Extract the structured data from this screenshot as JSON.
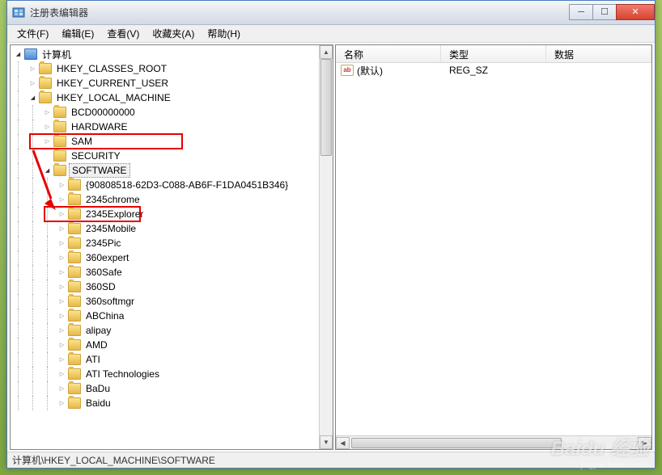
{
  "window": {
    "title": "注册表编辑器"
  },
  "menus": [
    "文件(F)",
    "编辑(E)",
    "查看(V)",
    "收藏夹(A)",
    "帮助(H)"
  ],
  "tree": {
    "root": "计算机",
    "nodes": [
      {
        "label": "HKEY_CLASSES_ROOT",
        "level": 1,
        "expanded": false
      },
      {
        "label": "HKEY_CURRENT_USER",
        "level": 1,
        "expanded": false
      },
      {
        "label": "HKEY_LOCAL_MACHINE",
        "level": 1,
        "expanded": true,
        "highlight": 1
      },
      {
        "label": "BCD00000000",
        "level": 2,
        "expanded": false
      },
      {
        "label": "HARDWARE",
        "level": 2,
        "expanded": false
      },
      {
        "label": "SAM",
        "level": 2,
        "expanded": false
      },
      {
        "label": "SECURITY",
        "level": 2,
        "expanded": null
      },
      {
        "label": "SOFTWARE",
        "level": 2,
        "expanded": true,
        "highlight": 2,
        "selected": true
      },
      {
        "label": "{90808518-62D3-C088-AB6F-F1DA0451B346}",
        "level": 3,
        "expanded": false
      },
      {
        "label": "2345chrome",
        "level": 3,
        "expanded": false
      },
      {
        "label": "2345Explorer",
        "level": 3,
        "expanded": false
      },
      {
        "label": "2345Mobile",
        "level": 3,
        "expanded": false
      },
      {
        "label": "2345Pic",
        "level": 3,
        "expanded": false
      },
      {
        "label": "360expert",
        "level": 3,
        "expanded": false
      },
      {
        "label": "360Safe",
        "level": 3,
        "expanded": false
      },
      {
        "label": "360SD",
        "level": 3,
        "expanded": false
      },
      {
        "label": "360softmgr",
        "level": 3,
        "expanded": false
      },
      {
        "label": "ABChina",
        "level": 3,
        "expanded": false
      },
      {
        "label": "alipay",
        "level": 3,
        "expanded": false
      },
      {
        "label": "AMD",
        "level": 3,
        "expanded": false
      },
      {
        "label": "ATI",
        "level": 3,
        "expanded": false
      },
      {
        "label": "ATI Technologies",
        "level": 3,
        "expanded": false
      },
      {
        "label": "BaDu",
        "level": 3,
        "expanded": false
      },
      {
        "label": "Baidu",
        "level": 3,
        "expanded": false
      }
    ]
  },
  "list": {
    "columns": [
      "名称",
      "类型",
      "数据"
    ],
    "rows": [
      {
        "name": "(默认)",
        "type": "REG_SZ",
        "data": ""
      }
    ]
  },
  "statusbar": "计算机\\HKEY_LOCAL_MACHINE\\SOFTWARE",
  "watermark": {
    "main": "Baidu 经验",
    "sub": "jingyan.baidu.com"
  },
  "icons": {
    "ab": "ab"
  }
}
